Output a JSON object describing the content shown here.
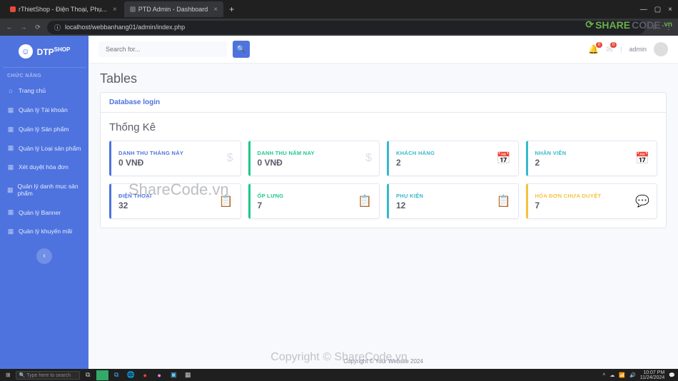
{
  "browser": {
    "tabs": [
      {
        "title": "rThietShop - Điện Thoại, Phụ..."
      },
      {
        "title": "PTD Admin - Dashboard"
      }
    ],
    "url": "localhost/webbanhang01/admin/index.php"
  },
  "brand": {
    "name_a": "DTP",
    "name_b": "SHOP"
  },
  "sidebar": {
    "heading": "CHỨC NĂNG",
    "items": [
      {
        "label": "Trang chủ",
        "icon": "⌂"
      },
      {
        "label": "Quản lý Tài khoản",
        "icon": "▦"
      },
      {
        "label": "Quản lý Sản phẩm",
        "icon": "▦"
      },
      {
        "label": "Quản lý Loại sản phẩm",
        "icon": "▦"
      },
      {
        "label": "Xét duyệt hóa đơn",
        "icon": "▦"
      },
      {
        "label": "Quản lý danh mục sản phẩm",
        "icon": "▦"
      },
      {
        "label": "Quản lý Banner",
        "icon": "▦"
      },
      {
        "label": "Quản lý khuyến mãi",
        "icon": "▦"
      }
    ]
  },
  "topbar": {
    "search_placeholder": "Search for...",
    "bell_badge": "0",
    "mail_badge": "0",
    "username": "admin"
  },
  "page": {
    "title": "Tables",
    "card_header": "Database login",
    "stat_title": "Thống Kê"
  },
  "stats_row1": [
    {
      "label": "DANH THU THÁNG NÀY",
      "value": "0 VNĐ",
      "color": "blue",
      "icon": "$"
    },
    {
      "label": "DANH THU NĂM NAY",
      "value": "0 VNĐ",
      "color": "green",
      "icon": "$"
    },
    {
      "label": "KHÁCH HÀNG",
      "value": "2",
      "color": "cyan",
      "icon": "📅"
    },
    {
      "label": "NHÂN VIÊN",
      "value": "2",
      "color": "cyan",
      "icon": "📅"
    }
  ],
  "stats_row2": [
    {
      "label": "ĐIỆN THOẠI",
      "value": "32",
      "color": "blue",
      "icon": "📋"
    },
    {
      "label": "ỐP LƯNG",
      "value": "7",
      "color": "green",
      "icon": "📋"
    },
    {
      "label": "PHỤ KIỆN",
      "value": "12",
      "color": "cyan",
      "icon": "📋"
    },
    {
      "label": "HÓA ĐƠN CHƯA DUYỆT",
      "value": "7",
      "color": "yellow",
      "icon": "💬"
    }
  ],
  "footer": "Copyright © Your Website 2024",
  "watermarks": {
    "logo": "SHARECODE.vn",
    "center": "ShareCode.vn",
    "bottom": "Copyright © ShareCode.vn"
  },
  "taskbar": {
    "search": "Type here to search",
    "time": "10:07 PM",
    "date": "11/24/2024"
  }
}
